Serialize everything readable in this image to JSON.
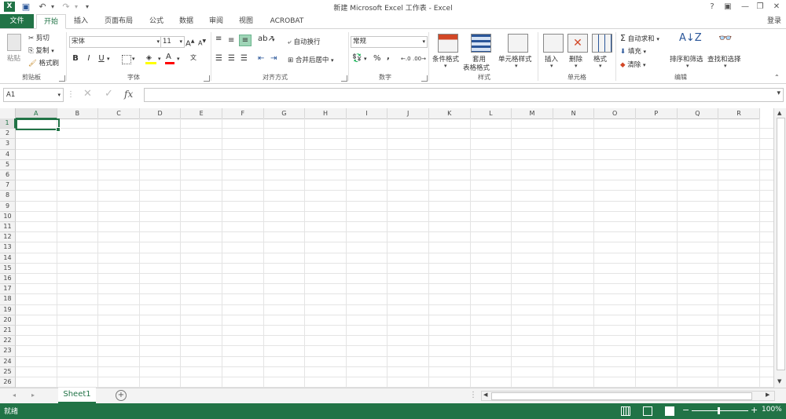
{
  "window": {
    "title": "新建 Microsoft Excel 工作表 - Excel",
    "help": "?",
    "ribbon_display": "▣",
    "minimize": "—",
    "restore": "❐",
    "close": "✕",
    "login": "登录"
  },
  "quick_access": {
    "undo_icon": "↶",
    "redo_icon": "↷",
    "save_icon": "▣",
    "dropdown": "▾"
  },
  "tabs": [
    "文件",
    "开始",
    "插入",
    "页面布局",
    "公式",
    "数据",
    "审阅",
    "视图",
    "ACROBAT"
  ],
  "clipboard": {
    "paste": "粘贴",
    "cut": "剪切",
    "copy": "复制",
    "format_painter": "格式刷",
    "group": "剪贴板"
  },
  "font": {
    "name": "宋体",
    "size": "11",
    "bold": "B",
    "italic": "I",
    "underline": "U",
    "grow": "A",
    "shrink": "A",
    "group": "字体"
  },
  "alignment": {
    "wrap": "自动换行",
    "merge": "合并后居中",
    "group": "对齐方式"
  },
  "number": {
    "format": "常规",
    "percent": "%",
    "comma": ",",
    "group": "数字"
  },
  "styles": {
    "conditional": "条件格式",
    "table_line1": "套用",
    "table_line2": "表格格式",
    "cell_styles": "单元格样式",
    "group": "样式"
  },
  "cells": {
    "insert": "插入",
    "delete": "删除",
    "format": "格式",
    "group": "单元格"
  },
  "editing": {
    "autosum": "自动求和",
    "fill": "填充",
    "clear": "清除",
    "sort": "排序和筛选",
    "find": "查找和选择",
    "group": "编辑"
  },
  "formula_bar": {
    "name_box": "A1",
    "fx": "fx",
    "cancel": "✕",
    "enter": "✓",
    "value": ""
  },
  "columns": [
    "A",
    "B",
    "C",
    "D",
    "E",
    "F",
    "G",
    "H",
    "I",
    "J",
    "K",
    "L",
    "M",
    "N",
    "O",
    "P",
    "Q",
    "R"
  ],
  "rows": [
    "1",
    "2",
    "3",
    "4",
    "5",
    "6",
    "7",
    "8",
    "9",
    "10",
    "11",
    "12",
    "13",
    "14",
    "15",
    "16",
    "17",
    "18",
    "19",
    "20",
    "21",
    "22",
    "23",
    "24",
    "25",
    "26"
  ],
  "sheets": {
    "active": "Sheet1",
    "add": "+"
  },
  "status": {
    "ready": "就绪",
    "zoom": "100%",
    "zoom_minus": "−",
    "zoom_plus": "+"
  },
  "colors": {
    "accent": "#217346",
    "highlight_yellow": "#ffff00",
    "font_red": "#ff0000",
    "selection": "#217346"
  }
}
